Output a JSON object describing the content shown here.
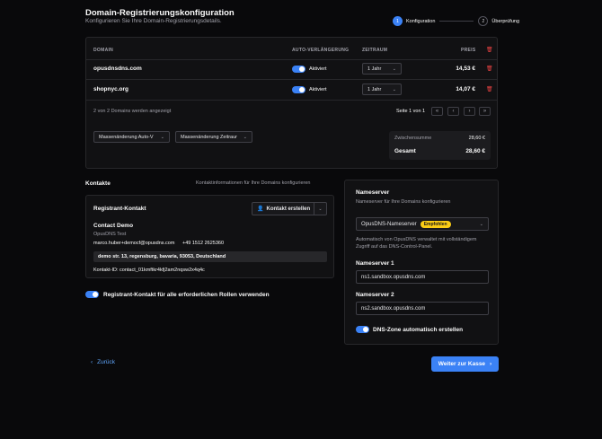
{
  "header": {
    "title": "Domain-Registrierungskonfiguration",
    "subtitle": "Konfigurieren Sie Ihre Domain-Registrierungsdetails.",
    "steps": [
      {
        "num": "1",
        "label": "Konfiguration"
      },
      {
        "num": "2",
        "label": "Überprüfung"
      }
    ]
  },
  "table": {
    "columns": {
      "domain": "DOMAIN",
      "auto_renew": "AUTO-VERLÄNGERUNG",
      "period": "ZEITRAUM",
      "price": "PREIS"
    },
    "rows": [
      {
        "domain": "opusdnsdns.com",
        "auto_renew": "Aktiviert",
        "period": "1 Jahr",
        "price": "14,53 €"
      },
      {
        "domain": "shopnyc.org",
        "auto_renew": "Aktiviert",
        "period": "1 Jahr",
        "price": "14,07 €"
      }
    ],
    "shown_text": "2 von 2 Domains werden angezeigt",
    "page_text": "Seite 1 von 1",
    "bulk_auto": "Massenänderung Auto-V",
    "bulk_period": "Massenänderung Zeitraur",
    "subtotal_label": "Zwischensumme",
    "subtotal_value": "28,60 €",
    "total_label": "Gesamt",
    "total_value": "28,60 €"
  },
  "contacts": {
    "heading": "Kontakte",
    "hint": "Kontaktinformationen für Ihre Domains konfigurieren",
    "registrant_label": "Registrant-Kontakt",
    "create_button": "Kontakt erstellen",
    "name": "Contact Demo",
    "org": "OpusDNS Test",
    "email": "marco.huber+democf@opusdns.com",
    "phone": "+49 1512 2625360",
    "address": "demo str. 13, regensburg, bavaria, 93053, Deutschland",
    "contact_id": "Kontakt-ID: contact_01kmftkr4kfj2am2nqsw2x4q4c",
    "use_for_all": "Registrant-Kontakt für alle erforderlichen Rollen verwenden"
  },
  "nameserver": {
    "heading": "Nameserver",
    "subtitle": "Nameserver für Ihre Domains konfigurieren",
    "selected": "OpusDNS-Nameserver",
    "badge": "Empfohlen",
    "description": "Automatisch von OpusDNS verwaltet mit vollständigem Zugriff auf das DNS-Control-Panel.",
    "ns1_label": "Nameserver 1",
    "ns1_value": "ns1.sandbox.opusdns.com",
    "ns2_label": "Nameserver 2",
    "ns2_value": "ns2.sandbox.opusdns.com",
    "dns_zone": "DNS-Zone automatisch erstellen"
  },
  "footer": {
    "back": "Zurück",
    "next": "Weiter zur Kasse"
  },
  "colors": {
    "accent": "#3b82f6",
    "danger": "#ef4444",
    "badge": "#facc15"
  }
}
